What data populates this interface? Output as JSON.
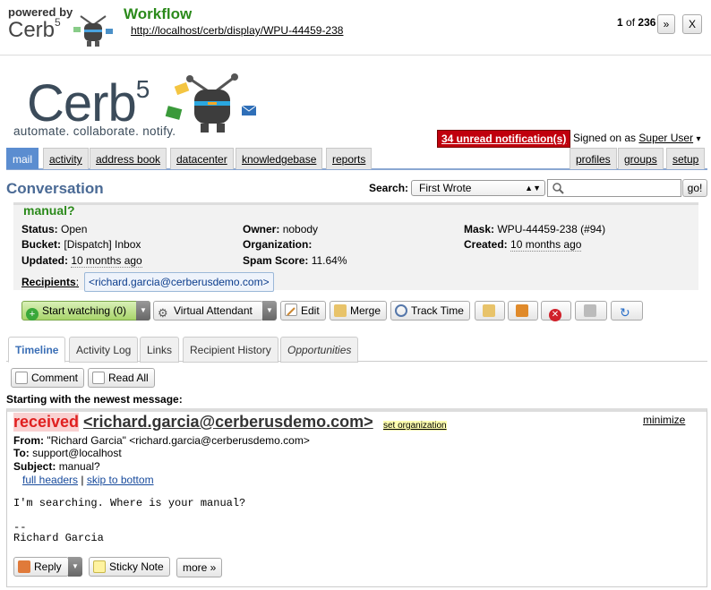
{
  "top": {
    "powered_by": "powered by",
    "brand_small": "Cerb",
    "brand_small_sup": "5",
    "page_title": "Workflow",
    "url": "http://localhost/cerb/display/WPU-44459-238",
    "pager_current": "1",
    "pager_of": "of",
    "pager_total": "236",
    "next_label": "»",
    "close_label": "X"
  },
  "logo": {
    "name": "Cerb",
    "sup": "5",
    "tagline": "automate. collaborate. notify."
  },
  "account": {
    "notifications": "34 unread notification(s)",
    "signed_on_as": "Signed on as",
    "user": "Super User",
    "user_arrow": "▾"
  },
  "nav": {
    "left": [
      "mail",
      "activity",
      "address book",
      "datacenter",
      "knowledgebase",
      "reports"
    ],
    "right": [
      "profiles",
      "groups",
      "setup"
    ],
    "active": "mail"
  },
  "search": {
    "title": "Conversation",
    "label": "Search:",
    "selected": "First Wrote",
    "go": "go!"
  },
  "ticket": {
    "subject": "manual?",
    "status_label": "Status:",
    "status": "Open",
    "bucket_label": "Bucket:",
    "bucket": "[Dispatch] Inbox",
    "updated_label": "Updated:",
    "updated": "10 months ago",
    "owner_label": "Owner:",
    "owner": "nobody",
    "org_label": "Organization:",
    "org": "",
    "spam_label": "Spam Score:",
    "spam": "11.64%",
    "mask_label": "Mask:",
    "mask": "WPU-44459-238 (#94)",
    "created_label": "Created:",
    "created": "10 months ago",
    "recipients_label": "Recipients",
    "recipients_colon": ":",
    "recipient": "<richard.garcia@cerberusdemo.com>"
  },
  "toolbar": {
    "watch": "Start watching (0)",
    "va": "Virtual Attendant",
    "edit": "Edit",
    "merge": "Merge",
    "track": "Track Time"
  },
  "tabs": [
    "Timeline",
    "Activity Log",
    "Links",
    "Recipient History",
    "Opportunities"
  ],
  "timeline": {
    "comment": "Comment",
    "read_all": "Read All",
    "newest": "Starting with the newest message:"
  },
  "message": {
    "received": "received",
    "sender": "<richard.garcia@cerberusdemo.com>",
    "set_org": "set organization",
    "minimize": "minimize",
    "from_label": "From:",
    "from": "\"Richard Garcia\" <richard.garcia@cerberusdemo.com>",
    "to_label": "To:",
    "to": "support@localhost",
    "subject_label": "Subject:",
    "subject": "manual?",
    "full_headers": "full headers",
    "sep": "|",
    "skip": "skip to bottom",
    "body_line1": "I'm searching.  Where is your manual?",
    "sig_dash": "--",
    "sig_name": "Richard Garcia",
    "reply": "Reply",
    "sticky": "Sticky Note",
    "more": "more »"
  },
  "colors": {
    "accent": "#5b8dd0",
    "green": "#2b8a1b",
    "alert": "#c0000d"
  }
}
